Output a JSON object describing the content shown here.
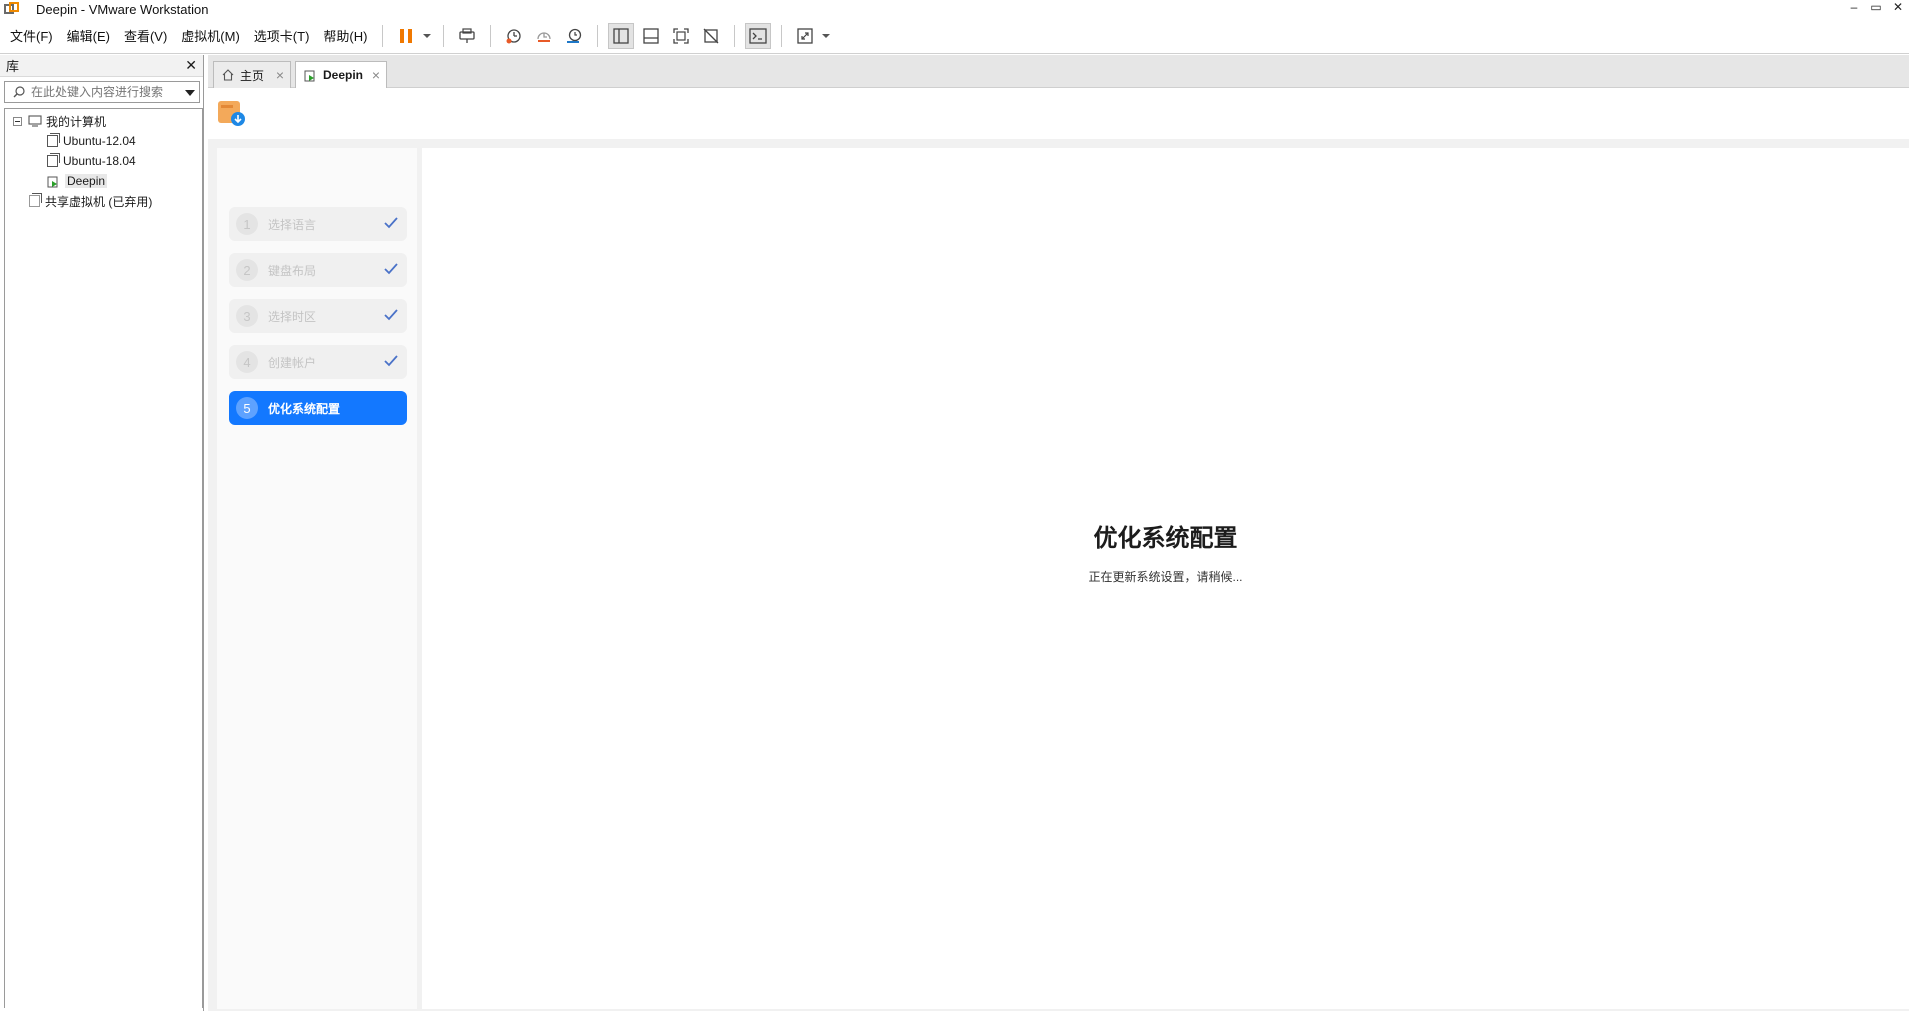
{
  "window": {
    "title": "Deepin - VMware Workstation",
    "buttons": [
      "–",
      "▭",
      "✕"
    ]
  },
  "menu": [
    "文件(F)",
    "编辑(E)",
    "查看(V)",
    "虚拟机(M)",
    "选项卡(T)",
    "帮助(H)"
  ],
  "toolbar": {
    "icons": [
      "pause-icon",
      "send-ctrl-alt-del-icon",
      "snapshot-icon",
      "revert-snapshot-icon",
      "snapshot-manager-icon",
      "show-library-icon",
      "show-thumbnail-icon",
      "full-screen-icon",
      "unity-icon",
      "console-view-icon",
      "stretch-icon"
    ],
    "accent": "#f07800"
  },
  "library": {
    "label": "库",
    "search_placeholder": "在此处键入内容进行搜索",
    "tree": {
      "root": "我的计算机",
      "vms": [
        "Ubuntu-12.04",
        "Ubuntu-18.04",
        "Deepin"
      ],
      "shared": "共享虚拟机 (已弃用)"
    }
  },
  "tabs": [
    {
      "label": "主页",
      "icon": "home-icon"
    },
    {
      "label": "Deepin",
      "icon": "vm-running-icon",
      "active": true
    }
  ],
  "installer": {
    "accent": "#1378ff",
    "steps": [
      {
        "num": "1",
        "label": "选择语言",
        "done": true
      },
      {
        "num": "2",
        "label": "键盘布局",
        "done": true
      },
      {
        "num": "3",
        "label": "选择时区",
        "done": true
      },
      {
        "num": "4",
        "label": "创建帐户",
        "done": true
      },
      {
        "num": "5",
        "label": "优化系统配置",
        "active": true
      }
    ],
    "title": "优化系统配置",
    "subtitle": "正在更新系统设置，请稍候..."
  }
}
